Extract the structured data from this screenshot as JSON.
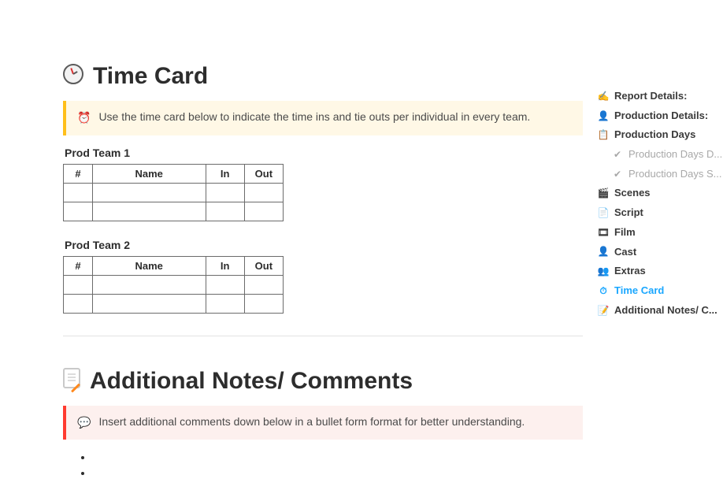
{
  "timecard": {
    "title": "Time Card",
    "callout_text": "Use the time card below to indicate the time ins and tie outs per individual in every team.",
    "teams": [
      {
        "label": "Prod Team 1",
        "headers": {
          "num": "#",
          "name": "Name",
          "in": "In",
          "out": "Out"
        }
      },
      {
        "label": "Prod Team 2",
        "headers": {
          "num": "#",
          "name": "Name",
          "in": "In",
          "out": "Out"
        }
      }
    ]
  },
  "notes": {
    "title": "Additional Notes/ Comments",
    "callout_text": "Insert additional comments down below in a bullet form format for better understanding."
  },
  "sidebar": {
    "items": [
      {
        "icon": "✍️",
        "label": "Report Details:",
        "class": ""
      },
      {
        "icon": "👤",
        "label": "Production Details:",
        "class": ""
      },
      {
        "icon": "📋",
        "label": "Production Days",
        "class": ""
      },
      {
        "icon": "✔",
        "label": "Production Days D...",
        "class": "sub"
      },
      {
        "icon": "✔",
        "label": "Production Days S...",
        "class": "sub"
      },
      {
        "icon": "🎬",
        "label": "Scenes",
        "class": ""
      },
      {
        "icon": "📄",
        "label": "Script",
        "class": ""
      },
      {
        "icon": "🎞",
        "label": "Film",
        "class": ""
      },
      {
        "icon": "👤",
        "label": "Cast",
        "class": ""
      },
      {
        "icon": "👥",
        "label": "Extras",
        "class": ""
      },
      {
        "icon": "⏱",
        "label": "Time Card",
        "class": "active"
      },
      {
        "icon": "📝",
        "label": "Additional Notes/ C...",
        "class": ""
      }
    ]
  }
}
